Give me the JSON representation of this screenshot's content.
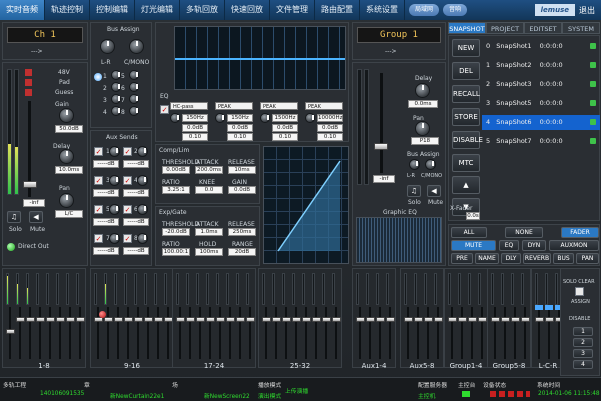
{
  "nav": {
    "tabs": [
      "实时音频",
      "轨迹控制",
      "控制编辑",
      "灯光编辑",
      "多轨回放",
      "快速回放",
      "文件管理",
      "路由配置",
      "系统设置"
    ],
    "pill1": "局域网",
    "pill2": "音响",
    "brand": "lemuse",
    "exit": "退出"
  },
  "channel": {
    "name": "Ch 1",
    "arrow": "--->",
    "pad_48v": "48V",
    "pad": "Pad",
    "guess": "Guess",
    "gain_label": "Gain",
    "gain_val": "50.0dB",
    "delay_label": "Delay",
    "delay_val": "10.0ms",
    "lr": "L-R",
    "cmono": "C/MONO",
    "bus_assign": "Bus Assign",
    "pan_label": "Pan",
    "pan_val": "L/C",
    "solo": "Solo",
    "mute": "Mute",
    "direct_out": "Direct Out",
    "level_val": "-inf"
  },
  "aux": {
    "title": "Aux Sends",
    "numbers": [
      "1",
      "2",
      "3",
      "4",
      "5",
      "6",
      "7",
      "8"
    ],
    "vals": [
      "-----dB",
      "-----dB",
      "-----dB",
      "-----dB",
      "-----dB",
      "-----dB",
      "-----dB",
      "-----dB"
    ]
  },
  "eq": {
    "title": "EQ",
    "bands": [
      "PEAK",
      "PEAK",
      "PEAK",
      "PEAK"
    ],
    "first": "HC-pass",
    "freqs": [
      "150Hz",
      "150Hz",
      "1500Hz",
      "10000Hz"
    ],
    "gains": [
      "0.0dB",
      "0.0dB",
      "0.0dB",
      "0.0dB"
    ],
    "qs": [
      "0.10",
      "0.10",
      "0.10",
      "0.10"
    ]
  },
  "comp": {
    "title": "Comp/Lim",
    "threshold": "THRESHOLD",
    "attack": "ATTACK",
    "release": "RELEASE",
    "ratio": "RATIO",
    "knee": "KNEE",
    "gain": "GAIN",
    "th_v": "0.00dB",
    "at_v": "200.0ms",
    "re_v": "10ms",
    "ra_v": "3.25:1",
    "kn_v": "0.0",
    "ga_v": "0.0dB"
  },
  "gate": {
    "title": "Exp/Gate",
    "threshold": "THRESHOLD",
    "attack": "ATTACK",
    "release": "RELEASE",
    "ratio": "RATIO",
    "hold": "HOLD",
    "range": "RANGE",
    "th_v": "-20.0dB",
    "at_v": "1.0ms",
    "re_v": "250ms",
    "ra_v": "100.00:1",
    "ho_v": "100ms",
    "rg_v": "20dB"
  },
  "group": {
    "name": "Group 1",
    "arrow": "--->",
    "delay_label": "Delay",
    "delay_val": "0.0ms",
    "pan_label": "Pan",
    "pan_val": "P18",
    "bus_assign": "Bus Assign",
    "lr": "L-R",
    "cmono": "C/MONO",
    "solo": "Solo",
    "mute": "Mute",
    "geq": "Graphic EQ",
    "level_val": "-inf"
  },
  "snapshot": {
    "tabs": [
      "SNAPSHOT",
      "PROJECT",
      "EDITSET",
      "SYSTEM"
    ],
    "buttons": [
      "NEW",
      "DEL",
      "RECALL",
      "STORE",
      "DISABLE",
      "MTC"
    ],
    "rows": [
      {
        "n": "0",
        "name": "SnapShot1",
        "t": "0:0:0:0"
      },
      {
        "n": "1",
        "name": "SnapShot2",
        "t": "0:0:0:0"
      },
      {
        "n": "2",
        "name": "SnapShot3",
        "t": "0:0:0:0"
      },
      {
        "n": "3",
        "name": "SnapShot5",
        "t": "0:0:0:0"
      },
      {
        "n": "4",
        "name": "SnapShot6",
        "t": "0:0:0:0"
      },
      {
        "n": "5",
        "name": "SnapShot7",
        "t": "0:0:0:0"
      }
    ],
    "xfader": "X-Fader",
    "xval": "0.0s"
  },
  "filter": {
    "row1": [
      "ALL",
      "NONE",
      "FADER"
    ],
    "row2": [
      "MUTE",
      "EQ",
      "DYN",
      "AUXMON"
    ],
    "row3": [
      "PRE",
      "NAME",
      "DLY",
      "REVERB",
      "BUS",
      "PAN"
    ]
  },
  "groups": [
    "1-8",
    "9-16",
    "17-24",
    "25-32",
    "Aux1-4",
    "Aux5-8",
    "Group1-4",
    "Group5-8",
    "L-C-R"
  ],
  "right_ctl": {
    "solo_clear": "SOLO CLEAR",
    "assign": "ASSIGN",
    "disable": "DISABLE",
    "nums": [
      "1",
      "2",
      "3",
      "4"
    ]
  },
  "status": {
    "l1": "多轨工程",
    "v1": "140106091535",
    "l2": "章",
    "v2": "新NewCurtain22e1",
    "l3": "场",
    "v3": "新NewScreen22",
    "l4": "播放模式",
    "v4": "演出模式",
    "l5": "上传演播",
    "l6": "配置服务器",
    "v6": "主控机",
    "l7": "主控台",
    "l8": "设备状态",
    "l9": "系统时间",
    "v9": "2014-01-06 11:15:48"
  }
}
